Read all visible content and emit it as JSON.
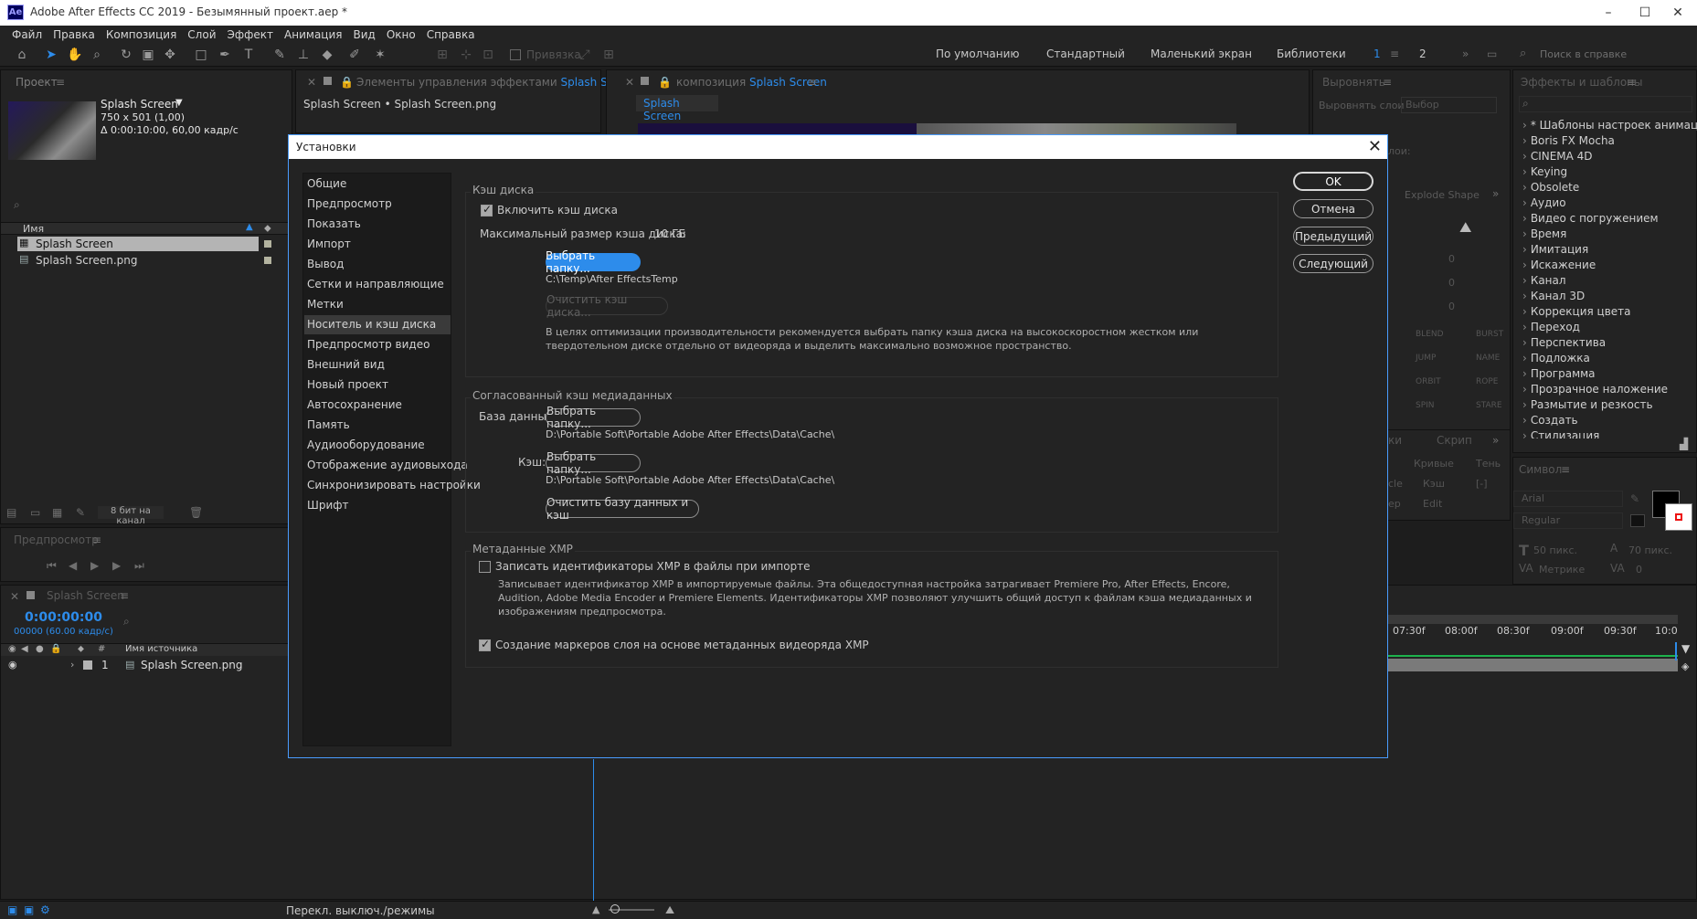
{
  "window": {
    "title": "Adobe After Effects CC 2019 - Безымянный проект.aep *",
    "logo": "Ae",
    "controls": {
      "minimize": "–",
      "maximize": "☐",
      "close": "✕"
    }
  },
  "menu": [
    "Файл",
    "Правка",
    "Композиция",
    "Слой",
    "Эффект",
    "Анимация",
    "Вид",
    "Окно",
    "Справка"
  ],
  "toolbar": {
    "snap_label": "Привязка",
    "workspaces": [
      "По умолчанию",
      "Стандартный",
      "Маленький экран",
      "Библиотеки"
    ],
    "ws_num1": "1",
    "ws_num2": "2",
    "help_search_placeholder": "Поиск в справке"
  },
  "project_panel": {
    "title": "Проект",
    "comp_name": "Splash Screen",
    "comp_size": "750 x 501 (1,00)",
    "comp_duration": "Δ 0:00:10:00, 60,00 кадр/с",
    "column_name": "Имя",
    "items": [
      "Splash Screen",
      "Splash Screen.png"
    ],
    "bit_depth": "8 бит на канал"
  },
  "effect_controls_panel": {
    "title_prefix": "Элементы управления эффектами",
    "title_target": "Splash Screen.pr",
    "subtitle": "Splash Screen • Splash Screen.png"
  },
  "composition_panel": {
    "title_prefix": "композиция",
    "title_target": "Splash Screen",
    "tab": "Splash Screen"
  },
  "align_panel": {
    "title": "Выровнять",
    "align_layers_to": "Выровнять слои",
    "align_target": "Выбор",
    "distribute_short": "лои:",
    "explode_shape": "Explode Shape",
    "motion_buttons": [
      "BLEND",
      "BURST",
      "JUMP",
      "NAME",
      "ORBIT",
      "ROPE",
      "SPIN",
      "STARE"
    ],
    "value_zero": "0"
  },
  "effects_panel": {
    "title": "Эффекты и шаблоны",
    "items": [
      "* Шаблоны настроек анимации",
      "Boris FX Mocha",
      "CINEMA 4D",
      "Keying",
      "Obsolete",
      "Аудио",
      "Видео с погружением",
      "Время",
      "Имитация",
      "Искажение",
      "Канал",
      "Канал 3D",
      "Коррекция цвета",
      "Переход",
      "Перспектива",
      "Подложка",
      "Программа",
      "Прозрачное наложение",
      "Размытие и резкость",
      "Создать",
      "Стилизация"
    ]
  },
  "tracker_panel": {
    "tabs": [
      "ки",
      "Скрип"
    ],
    "items": [
      "Кривые",
      "Тень",
      "cle",
      "Кэш",
      "[-]",
      "ер",
      "Edit"
    ]
  },
  "character_panel": {
    "title": "Символ",
    "font": "Arial",
    "style": "Regular",
    "size": "50 пикс.",
    "leading": "70 пикс.",
    "kerning": "Метрике",
    "tracking": "0"
  },
  "preview_panel": {
    "title": "Предпросмотр"
  },
  "timeline_panel": {
    "title": "Splash Screen",
    "timecode": "0:00:00:00",
    "frames": "00000 (60.00 кадр/с)",
    "col_source": "Имя источника",
    "layer_num": "1",
    "layer_name": "Splash Screen.png",
    "ruler": [
      "07:30f",
      "08:00f",
      "08:30f",
      "09:00f",
      "09:30f",
      "10:0"
    ],
    "bottom_label": "Перекл. выключ./режимы"
  },
  "dialog": {
    "title": "Установки",
    "close": "✕",
    "sidebar": [
      "Общие",
      "Предпросмотр",
      "Показать",
      "Импорт",
      "Вывод",
      "Сетки и направляющие",
      "Метки",
      "Носитель и кэш диска",
      "Предпросмотр видео",
      "Внешний вид",
      "Новый проект",
      "Автосохранение",
      "Память",
      "Аудиооборудование",
      "Отображение аудиовыхода",
      "Синхронизировать настройки",
      "Шрифт"
    ],
    "selected_index": 7,
    "buttons": {
      "ok": "OK",
      "cancel": "Отмена",
      "prev": "Предыдущий",
      "next": "Следующий"
    },
    "disk_cache": {
      "group_title": "Кэш диска",
      "enable_label": "Включить кэш диска",
      "enable_checked": true,
      "max_size_label": "Максимальный размер кэша диска:",
      "max_size_value": "10 ГБ",
      "choose_folder": "Выбрать папку...",
      "path": "C:\\Temp\\After EffectsTemp",
      "clear_label": "Очистить кэш диска...",
      "hint": "В целях оптимизации производительности рекомендуется выбрать папку кэша диска на высокоскоростном жестком или твердотельном диске отдельно от видеоряда и выделить максимально возможное пространство."
    },
    "media_cache": {
      "group_title": "Согласованный кэш медиаданных",
      "db_label": "База данных:",
      "db_button": "Выбрать папку...",
      "db_path": "D:\\Portable Soft\\Portable Adobe After Effects\\Data\\Cache\\",
      "cache_label": "Кэш:",
      "cache_button": "Выбрать папку...",
      "cache_path": "D:\\Portable Soft\\Portable Adobe After Effects\\Data\\Cache\\",
      "clean_button": "Очистить базу данных и кэш"
    },
    "xmp": {
      "group_title": "Метаданные XMP",
      "write_label": "Записать идентификаторы XMP в файлы при импорте",
      "write_checked": false,
      "write_hint": "Записывает идентификатор XMP в импортируемые файлы. Эта общедоступная настройка затрагивает Premiere Pro, After Effects, Encore, Audition, Adobe Media Encoder и Premiere Elements. Идентификаторы XMP позволяют улучшить общий доступ к файлам кэша медиаданных и изображениям предпросмотра.",
      "markers_label": "Создание маркеров слоя на основе метаданных видеоряда XMP",
      "markers_checked": true
    }
  },
  "colors": {
    "accent": "#2d8ceb",
    "dialog_border": "#4a9cff",
    "bg": "#1d1d1d",
    "panel": "#232323"
  }
}
